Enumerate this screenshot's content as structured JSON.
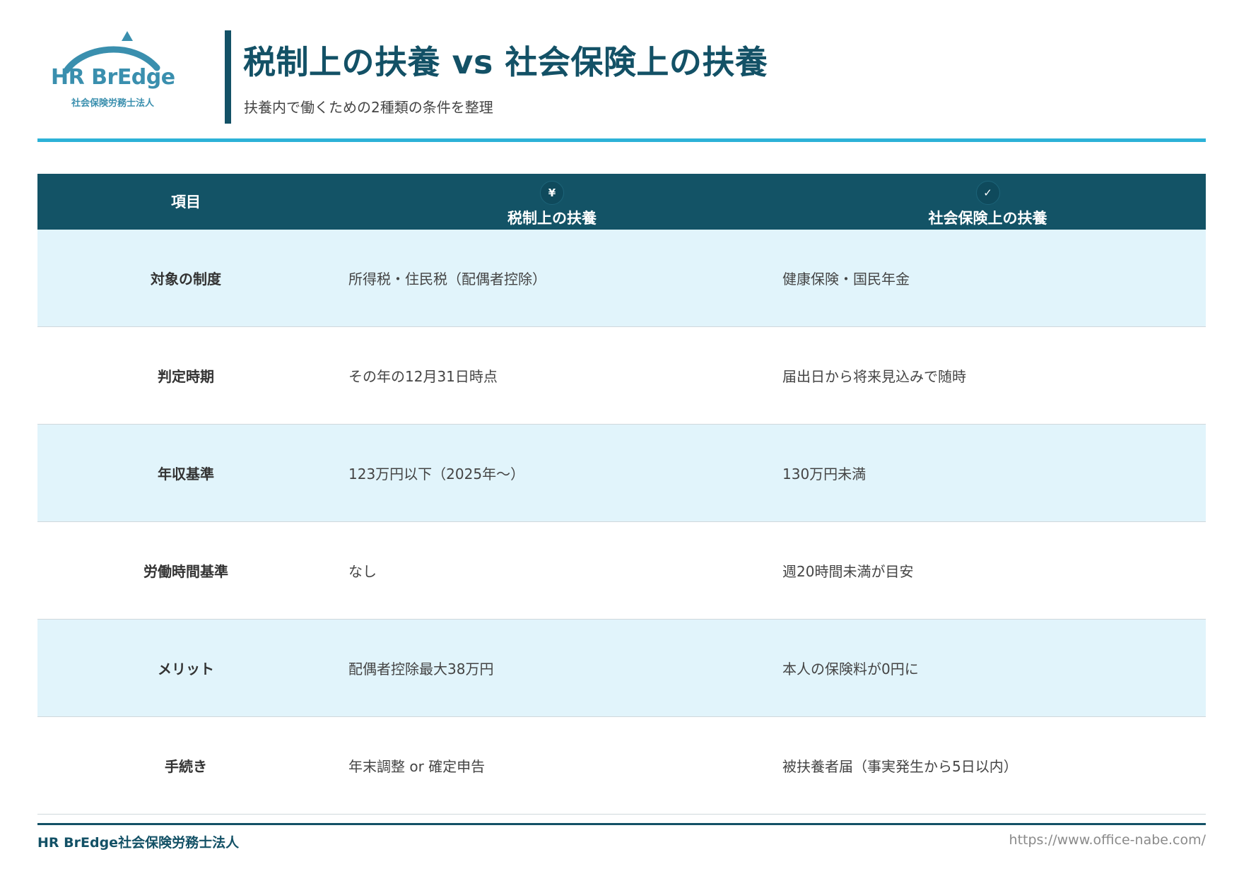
{
  "brand": {
    "logo_name": "HR BrEdge",
    "logo_sub": "社会保険労務士法人",
    "colors": {
      "logo": "#3a8fae",
      "primary": "#135166",
      "accent": "#2cb2d7",
      "row_alt": "#e1f4fb"
    }
  },
  "header": {
    "title": "税制上の扶養 vs 社会保険上の扶養",
    "subtitle": "扶養内で働くための2種類の条件を整理"
  },
  "table": {
    "columns": [
      {
        "label": "項目",
        "icon": ""
      },
      {
        "label": "税制上の扶養",
        "icon": "¥",
        "icon_name": "yen-icon"
      },
      {
        "label": "社会保険上の扶養",
        "icon": "✓",
        "icon_name": "shield-check-icon"
      }
    ],
    "rows": [
      {
        "label": "対象の制度",
        "tax": "所得税・住民税（配偶者控除）",
        "social": "健康保険・国民年金"
      },
      {
        "label": "判定時期",
        "tax": "その年の12月31日時点",
        "social": "届出日から将来見込みで随時"
      },
      {
        "label": "年収基準",
        "tax": "123万円以下（2025年〜）",
        "social": "130万円未満"
      },
      {
        "label": "労働時間基準",
        "tax": "なし",
        "social": "週20時間未満が目安"
      },
      {
        "label": "メリット",
        "tax": "配偶者控除最大38万円",
        "social": "本人の保険料が0円に"
      },
      {
        "label": "手続き",
        "tax": "年末調整 or 確定申告",
        "social": "被扶養者届（事実発生から5日以内）"
      }
    ]
  },
  "footer": {
    "company": "HR BrEdge社会保険労務士法人",
    "url": "https://www.office-nabe.com/"
  }
}
